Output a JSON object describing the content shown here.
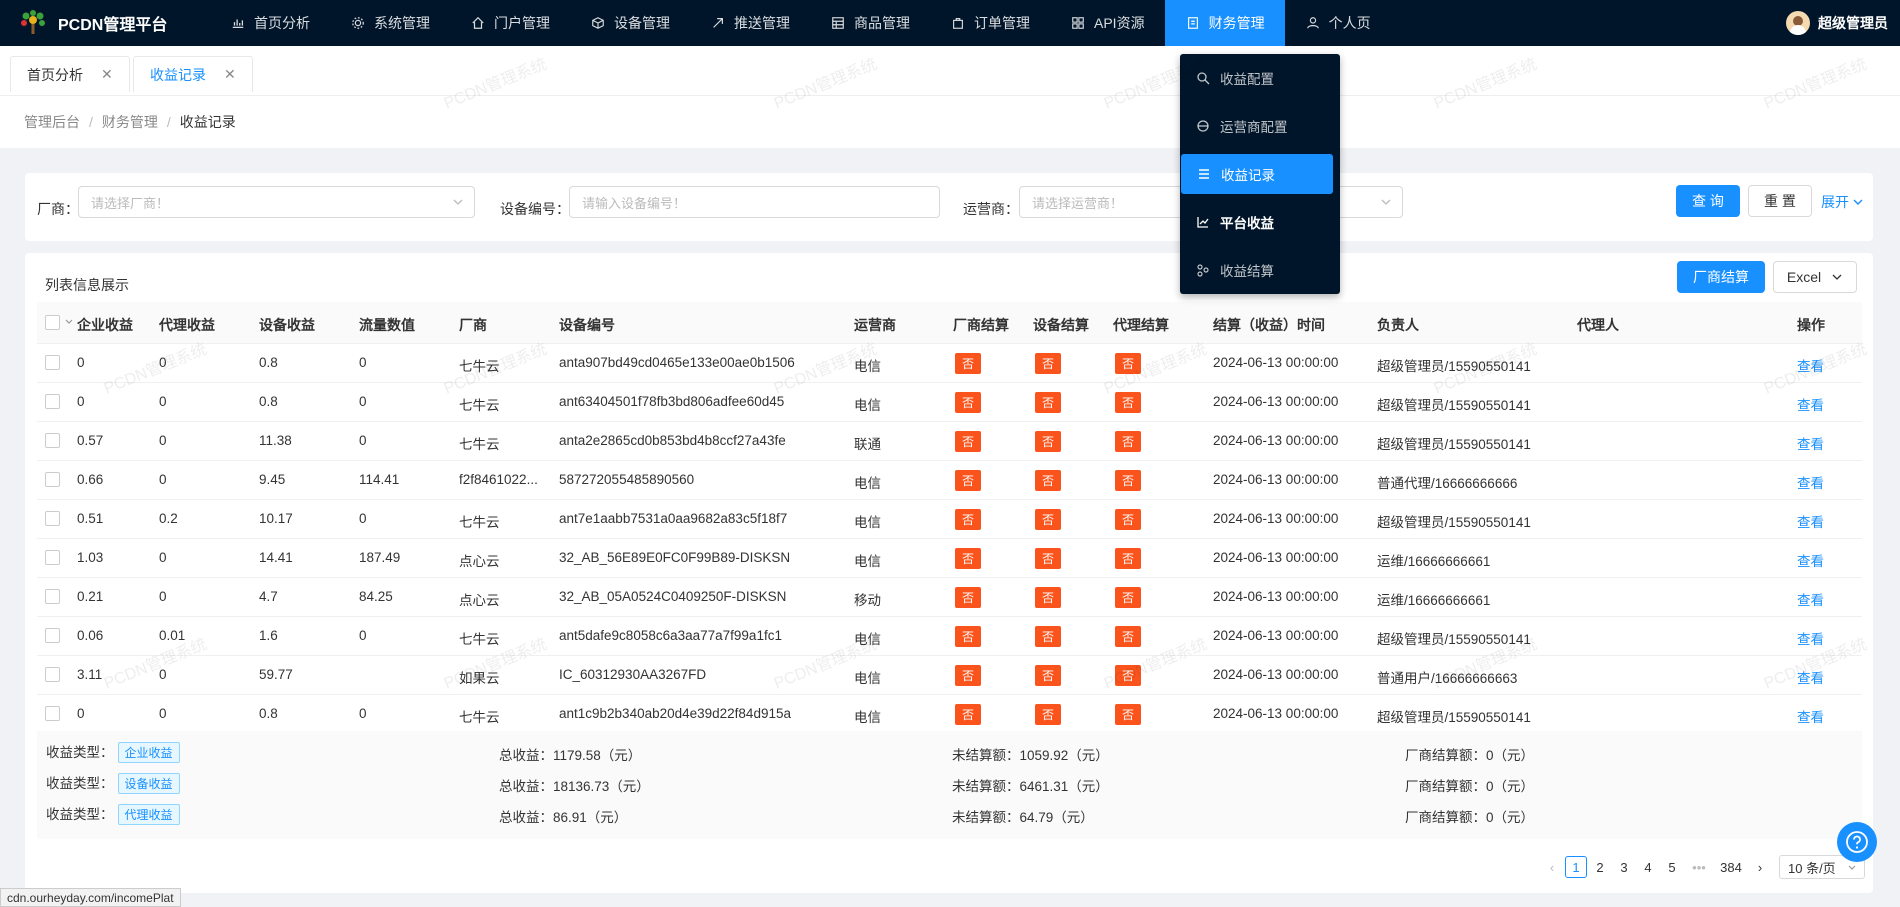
{
  "app": {
    "title": "PCDN管理平台",
    "user": "超级管理员",
    "watermark": "PCDN管理系统"
  },
  "nav": [
    {
      "label": "首页分析",
      "icon": "chart-icon"
    },
    {
      "label": "系统管理",
      "icon": "gear-icon"
    },
    {
      "label": "门户管理",
      "icon": "home-icon"
    },
    {
      "label": "设备管理",
      "icon": "cube-icon"
    },
    {
      "label": "推送管理",
      "icon": "send-icon"
    },
    {
      "label": "商品管理",
      "icon": "table-icon"
    },
    {
      "label": "订单管理",
      "icon": "bag-icon"
    },
    {
      "label": "API资源",
      "icon": "grid-icon"
    },
    {
      "label": "财务管理",
      "icon": "doc-icon"
    },
    {
      "label": "个人页",
      "icon": "user-icon"
    }
  ],
  "dropdown": [
    {
      "label": "收益配置"
    },
    {
      "label": "运营商配置"
    },
    {
      "label": "收益记录"
    },
    {
      "label": "平台收益"
    },
    {
      "label": "收益结算"
    }
  ],
  "tabs": [
    {
      "label": "首页分析"
    },
    {
      "label": "收益记录"
    }
  ],
  "breadcrumb": [
    "管理后台",
    "财务管理",
    "收益记录"
  ],
  "filters": {
    "vendor_label": "厂商：",
    "vendor_placeholder": "请选择厂商！",
    "device_label": "设备编号：",
    "device_placeholder": "请输入设备编号！",
    "operator_label": "运营商：",
    "operator_placeholder": "请选择运营商！",
    "query": "查 询",
    "reset": "重 置",
    "expand": "展开"
  },
  "list": {
    "title": "列表信息展示",
    "settle_button": "厂商结算",
    "excel_button": "Excel"
  },
  "columns": [
    "企业收益",
    "代理收益",
    "设备收益",
    "流量数值",
    "厂商",
    "设备编号",
    "运营商",
    "厂商结算",
    "设备结算",
    "代理结算",
    "结算（收益）时间",
    "负责人",
    "代理人",
    "操作"
  ],
  "rows": [
    [
      "0",
      "0",
      "0.8",
      "0",
      "七牛云",
      "anta907bd49cd0465e133e00ae0b1506",
      "电信",
      "否",
      "否",
      "否",
      "2024-06-13 00:00:00",
      "超级管理员/15590550141",
      "",
      "查看"
    ],
    [
      "0",
      "0",
      "0.8",
      "0",
      "七牛云",
      "ant63404501f78fb3bd806adfee60d45",
      "电信",
      "否",
      "否",
      "否",
      "2024-06-13 00:00:00",
      "超级管理员/15590550141",
      "",
      "查看"
    ],
    [
      "0.57",
      "0",
      "11.38",
      "0",
      "七牛云",
      "anta2e2865cd0b853bd4b8ccf27a43fe",
      "联通",
      "否",
      "否",
      "否",
      "2024-06-13 00:00:00",
      "超级管理员/15590550141",
      "",
      "查看"
    ],
    [
      "0.66",
      "0",
      "9.45",
      "114.41",
      "f2f8461022...",
      "587272055485890560",
      "电信",
      "否",
      "否",
      "否",
      "2024-06-13 00:00:00",
      "普通代理/16666666666",
      "",
      "查看"
    ],
    [
      "0.51",
      "0.2",
      "10.17",
      "0",
      "七牛云",
      "ant7e1aabb7531a0aa9682a83c5f18f7",
      "电信",
      "否",
      "否",
      "否",
      "2024-06-13 00:00:00",
      "超级管理员/15590550141",
      "",
      "查看"
    ],
    [
      "1.03",
      "0",
      "14.41",
      "187.49",
      "点心云",
      "32_AB_56E89E0FC0F99B89-DISKSN",
      "电信",
      "否",
      "否",
      "否",
      "2024-06-13 00:00:00",
      "运维/16666666661",
      "",
      "查看"
    ],
    [
      "0.21",
      "0",
      "4.7",
      "84.25",
      "点心云",
      "32_AB_05A0524C0409250F-DISKSN",
      "移动",
      "否",
      "否",
      "否",
      "2024-06-13 00:00:00",
      "运维/16666666661",
      "",
      "查看"
    ],
    [
      "0.06",
      "0.01",
      "1.6",
      "0",
      "七牛云",
      "ant5dafe9c8058c6a3aa77a7f99a1fc1",
      "电信",
      "否",
      "否",
      "否",
      "2024-06-13 00:00:00",
      "超级管理员/15590550141",
      "",
      "查看"
    ],
    [
      "3.11",
      "0",
      "59.77",
      "",
      "如果云",
      "IC_60312930AA3267FD",
      "电信",
      "否",
      "否",
      "否",
      "2024-06-13 00:00:00",
      "普通用户/16666666663",
      "",
      "查看"
    ],
    [
      "0",
      "0",
      "0.8",
      "0",
      "七牛云",
      "ant1c9b2b340ab20d4e39d22f84d915a",
      "电信",
      "否",
      "否",
      "否",
      "2024-06-13 00:00:00",
      "超级管理员/15590550141",
      "",
      "查看"
    ]
  ],
  "summary": [
    {
      "type_label": "收益类型：",
      "type": "企业收益",
      "total": "总收益：1179.58（元）",
      "unsettled": "未结算额：1059.92（元）",
      "vendor": "厂商结算额：0（元）"
    },
    {
      "type_label": "收益类型：",
      "type": "设备收益",
      "total": "总收益：18136.73（元）",
      "unsettled": "未结算额：6461.31（元）",
      "vendor": "厂商结算额：0（元）"
    },
    {
      "type_label": "收益类型：",
      "type": "代理收益",
      "total": "总收益：86.91（元）",
      "unsettled": "未结算额：64.79（元）",
      "vendor": "厂商结算额：0（元）"
    }
  ],
  "pagination": {
    "pages": [
      "1",
      "2",
      "3",
      "4",
      "5"
    ],
    "ellipsis": "•••",
    "last": "384",
    "size": "10 条/页",
    "current": 1
  },
  "status_url": "cdn.ourheyday.com/incomePlat"
}
